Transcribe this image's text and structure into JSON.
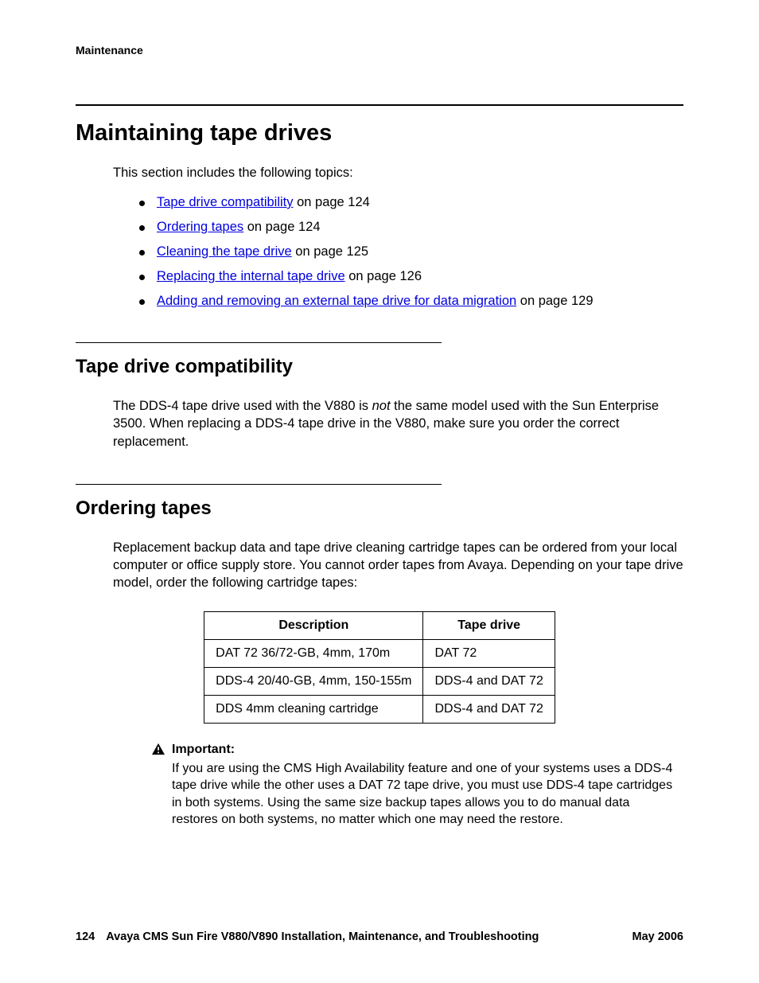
{
  "header": {
    "section_label": "Maintenance"
  },
  "h1": "Maintaining tape drives",
  "intro": "This section includes the following topics:",
  "topics": [
    {
      "link": "Tape drive compatibility",
      "suffix": " on page 124"
    },
    {
      "link": "Ordering tapes",
      "suffix": " on page 124"
    },
    {
      "link": "Cleaning the tape drive",
      "suffix": " on page 125"
    },
    {
      "link": "Replacing the internal tape drive",
      "suffix": " on page 126"
    },
    {
      "link": "Adding and removing an external tape drive for data migration",
      "suffix": " on page 129"
    }
  ],
  "section1": {
    "heading": "Tape drive compatibility",
    "p1a": "The DDS-4 tape drive used with the V880 is ",
    "p1_em": "not",
    "p1b": " the same model used with the Sun Enterprise 3500. When replacing a DDS-4 tape drive in the V880, make sure you order the correct replacement."
  },
  "section2": {
    "heading": "Ordering tapes",
    "p1": "Replacement backup data and tape drive cleaning cartridge tapes can be ordered from your local computer or office supply store. You cannot order tapes from Avaya. Depending on your tape drive model, order the following cartridge tapes:",
    "table": {
      "headers": [
        "Description",
        "Tape drive"
      ],
      "rows": [
        [
          "DAT 72 36/72-GB, 4mm, 170m",
          "DAT 72"
        ],
        [
          "DDS-4 20/40-GB, 4mm, 150-155m",
          "DDS-4 and DAT 72"
        ],
        [
          "DDS 4mm cleaning cartridge",
          "DDS-4 and DAT 72"
        ]
      ]
    },
    "note": {
      "label": "Important:",
      "text": "If you are using the CMS High Availability feature and one of your systems uses a DDS-4 tape drive while the other uses a DAT 72 tape drive, you must use DDS-4 tape cartridges in both systems. Using the same size backup tapes allows you to do manual data restores on both systems, no matter which one may need the restore."
    }
  },
  "footer": {
    "page": "124",
    "title": "Avaya CMS Sun Fire V880/V890 Installation, Maintenance, and Troubleshooting",
    "date": "May 2006"
  }
}
